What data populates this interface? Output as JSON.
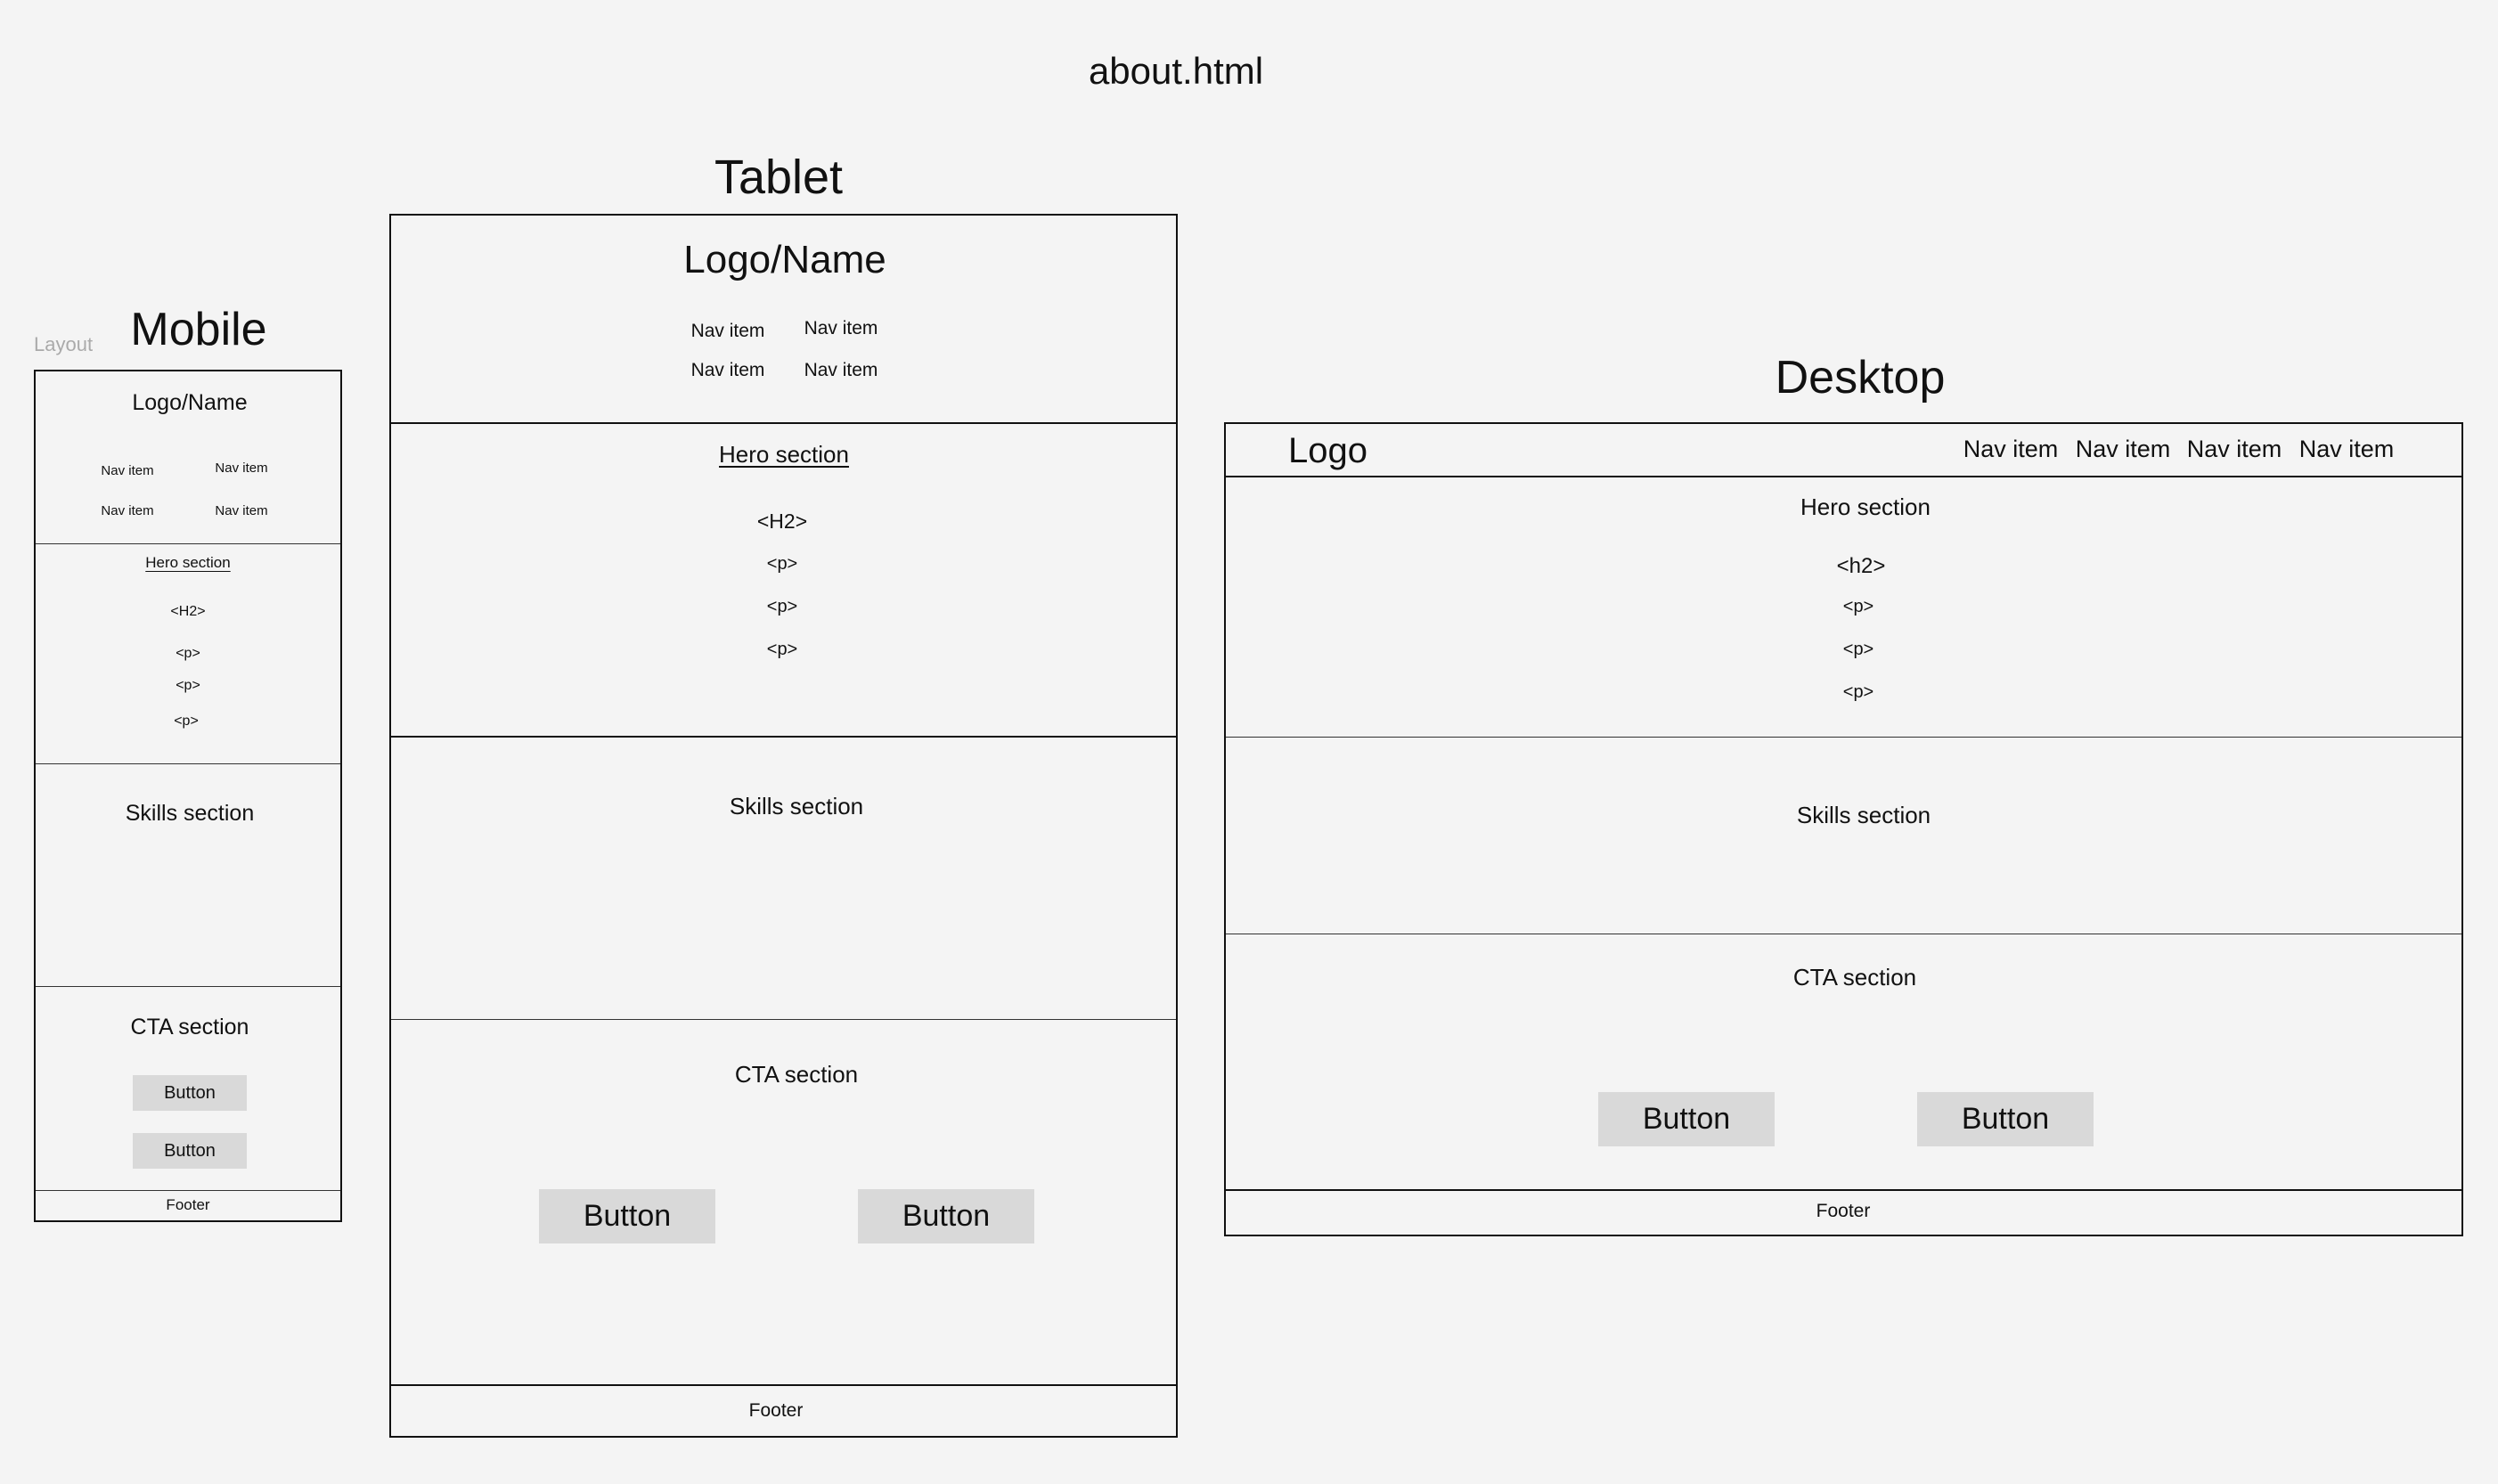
{
  "page_title": "about.html",
  "layout_label": "Layout",
  "mobile": {
    "heading": "Mobile",
    "logo": "Logo/Name",
    "nav": [
      "Nav item",
      "Nav item",
      "Nav item",
      "Nav item"
    ],
    "hero": {
      "title": "Hero section",
      "h2": "<H2>",
      "paragraphs": [
        "<p>",
        "<p>",
        "<p>"
      ]
    },
    "skills": "Skills section",
    "cta": {
      "title": "CTA section",
      "buttons": [
        "Button",
        "Button"
      ]
    },
    "footer": "Footer"
  },
  "tablet": {
    "heading": "Tablet",
    "logo": "Logo/Name",
    "nav": [
      "Nav item",
      "Nav item",
      "Nav item",
      "Nav item"
    ],
    "hero": {
      "title": "Hero section",
      "h2": "<H2>",
      "paragraphs": [
        "<p>",
        "<p>",
        "<p>"
      ]
    },
    "skills": "Skills section",
    "cta": {
      "title": "CTA section",
      "buttons": [
        "Button",
        "Button"
      ]
    },
    "footer": "Footer"
  },
  "desktop": {
    "heading": "Desktop",
    "logo": "Logo",
    "nav": [
      "Nav item",
      "Nav item",
      "Nav item",
      "Nav item"
    ],
    "hero": {
      "title": "Hero section",
      "h2": "<h2>",
      "paragraphs": [
        "<p>",
        "<p>",
        "<p>"
      ]
    },
    "skills": "Skills section",
    "cta": {
      "title": "CTA section",
      "buttons": [
        "Button",
        "Button"
      ]
    },
    "footer": "Footer"
  }
}
